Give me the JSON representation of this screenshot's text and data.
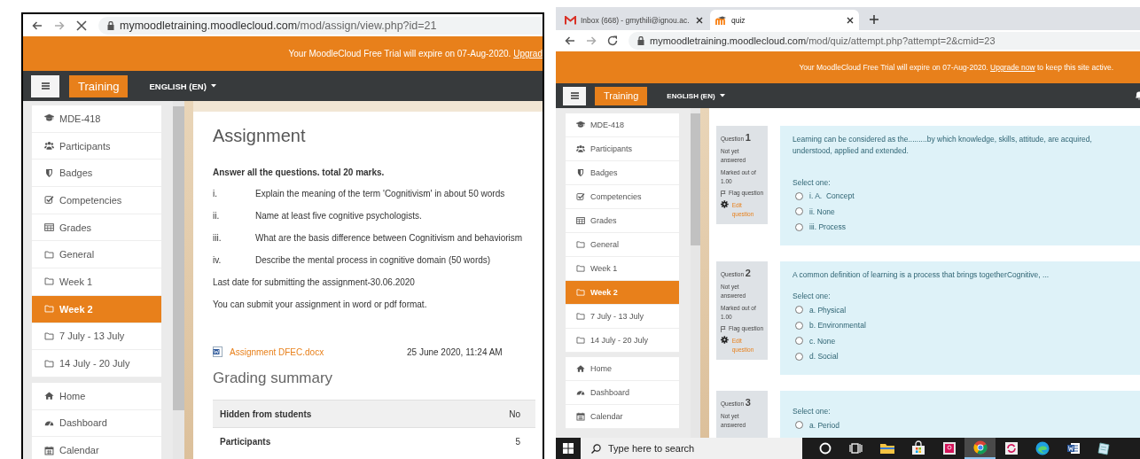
{
  "windows": [
    {
      "kind": "assignment",
      "loading": true,
      "url": {
        "host": "mymoodletraining.moodlecloud.com",
        "path": "/mod/assign/view.php?id=21"
      },
      "banner": {
        "text": "Your MoodleCloud Free Trial will expire on 07-Aug-2020.",
        "link": "Upgrad"
      },
      "navbar": {
        "brand": "Training",
        "language": "ENGLISH (EN)"
      },
      "sidebar": {
        "sections": [
          {
            "items": [
              {
                "label": "MDE-418",
                "selected": false
              },
              {
                "label": "Participants",
                "selected": false
              },
              {
                "label": "Badges",
                "selected": false
              },
              {
                "label": "Competencies",
                "selected": false
              },
              {
                "label": "Grades",
                "selected": false
              },
              {
                "label": "General",
                "selected": false
              },
              {
                "label": "Week 1",
                "selected": false
              },
              {
                "label": "Week 2",
                "selected": true
              },
              {
                "label": "7 July - 13 July",
                "selected": false
              },
              {
                "label": "14 July - 20 July",
                "selected": false
              }
            ]
          },
          {
            "items": [
              {
                "label": "Home",
                "selected": false
              },
              {
                "label": "Dashboard",
                "selected": false
              },
              {
                "label": "Calendar",
                "selected": false
              }
            ]
          }
        ]
      },
      "assignment": {
        "title": "Assignment",
        "intro": "Answer all the questions.  total 20 marks.",
        "questions": [
          {
            "number": "i.",
            "text": "Explain the meaning of the term 'Cognitivism' in about 50 words"
          },
          {
            "number": "ii.",
            "text": "Name at least five cognitive psychologists."
          },
          {
            "number": "iii.",
            "text": "What are the basis difference between Cognitivism and behaviorism"
          },
          {
            "number": "iv.",
            "text": "Describe the mental process in cognitive domain (50 words)"
          }
        ],
        "notes": [
          "Last date for submitting the assignment-30.06.2020",
          "You can submit your assignment in word or pdf format."
        ],
        "file": {
          "name": "Assignment DFEC.docx",
          "date": "25 June 2020, 11:24 AM"
        },
        "grading": {
          "title": "Grading summary",
          "rows": [
            {
              "label": "Hidden from students",
              "value": "No"
            },
            {
              "label": "Participants",
              "value": "5"
            }
          ]
        }
      }
    },
    {
      "kind": "quiz",
      "loading": false,
      "tabs": [
        {
          "title": "Inbox (668) - gmythili@ignou.ac.",
          "selected": false
        },
        {
          "title": "quiz",
          "selected": true
        }
      ],
      "url": {
        "host": "mymoodletraining.moodlecloud.com",
        "path": "/mod/quiz/attempt.php?attempt=2&cmid=23"
      },
      "banner": {
        "text": "Your MoodleCloud Free Trial will expire on 07-Aug-2020.",
        "link": "Upgrade now",
        "after": "to keep this site active."
      },
      "navbar": {
        "brand": "Training",
        "language": "ENGLISH (EN)"
      },
      "sidebar": {
        "sections": [
          {
            "items": [
              {
                "label": "MDE-418",
                "selected": false
              },
              {
                "label": "Participants",
                "selected": false
              },
              {
                "label": "Badges",
                "selected": false
              },
              {
                "label": "Competencies",
                "selected": false
              },
              {
                "label": "Grades",
                "selected": false
              },
              {
                "label": "General",
                "selected": false
              },
              {
                "label": "Week 1",
                "selected": false
              },
              {
                "label": "Week 2",
                "selected": true
              },
              {
                "label": "7 July - 13 July",
                "selected": false
              },
              {
                "label": "14 July - 20 July",
                "selected": false
              }
            ]
          },
          {
            "items": [
              {
                "label": "Home",
                "selected": false
              },
              {
                "label": "Dashboard",
                "selected": false
              },
              {
                "label": "Calendar",
                "selected": false
              }
            ]
          }
        ]
      },
      "quiz": {
        "questions": [
          {
            "label": "Question",
            "number": "1",
            "status": "Not yet answered",
            "marks": "Marked out of 1.00",
            "flag": "Flag question",
            "edit": "Edit question",
            "text": "Learning can be considered as the.........by which knowledge, skills, attitude, are acquired, understood, applied and extended.",
            "prompt": "Select one:",
            "options": [
              {
                "label": "i. A.  Concept",
                "selected": false
              },
              {
                "label": "ii. None",
                "selected": false
              },
              {
                "label": "iii. Process",
                "selected": false
              }
            ]
          },
          {
            "label": "Question",
            "number": "2",
            "status": "Not yet answered",
            "marks": "Marked out of 1.00",
            "flag": "Flag question",
            "edit": "Edit question",
            "text": "A common definition of learning is a process that brings togetherCognitive, ...",
            "prompt": "Select one:",
            "options": [
              {
                "label": "a. Physical",
                "selected": false
              },
              {
                "label": "b. Environmental",
                "selected": false
              },
              {
                "label": "c. None",
                "selected": false
              },
              {
                "label": "d. Social",
                "selected": false
              }
            ]
          },
          {
            "label": "Question",
            "number": "3",
            "status": "Not yet answered",
            "prompt": "Select one:",
            "options": [
              {
                "label": "a. Period",
                "selected": false
              }
            ]
          }
        ]
      }
    }
  ],
  "taskbar": {
    "search": {
      "placeholder": "Type here to search"
    },
    "apps": [
      {
        "active": false
      },
      {
        "active": false
      },
      {
        "active": false
      },
      {
        "active": false
      },
      {
        "active": false
      },
      {
        "active": true
      },
      {
        "active": false
      },
      {
        "active": false
      },
      {
        "active": false
      },
      {
        "active": false
      }
    ]
  }
}
